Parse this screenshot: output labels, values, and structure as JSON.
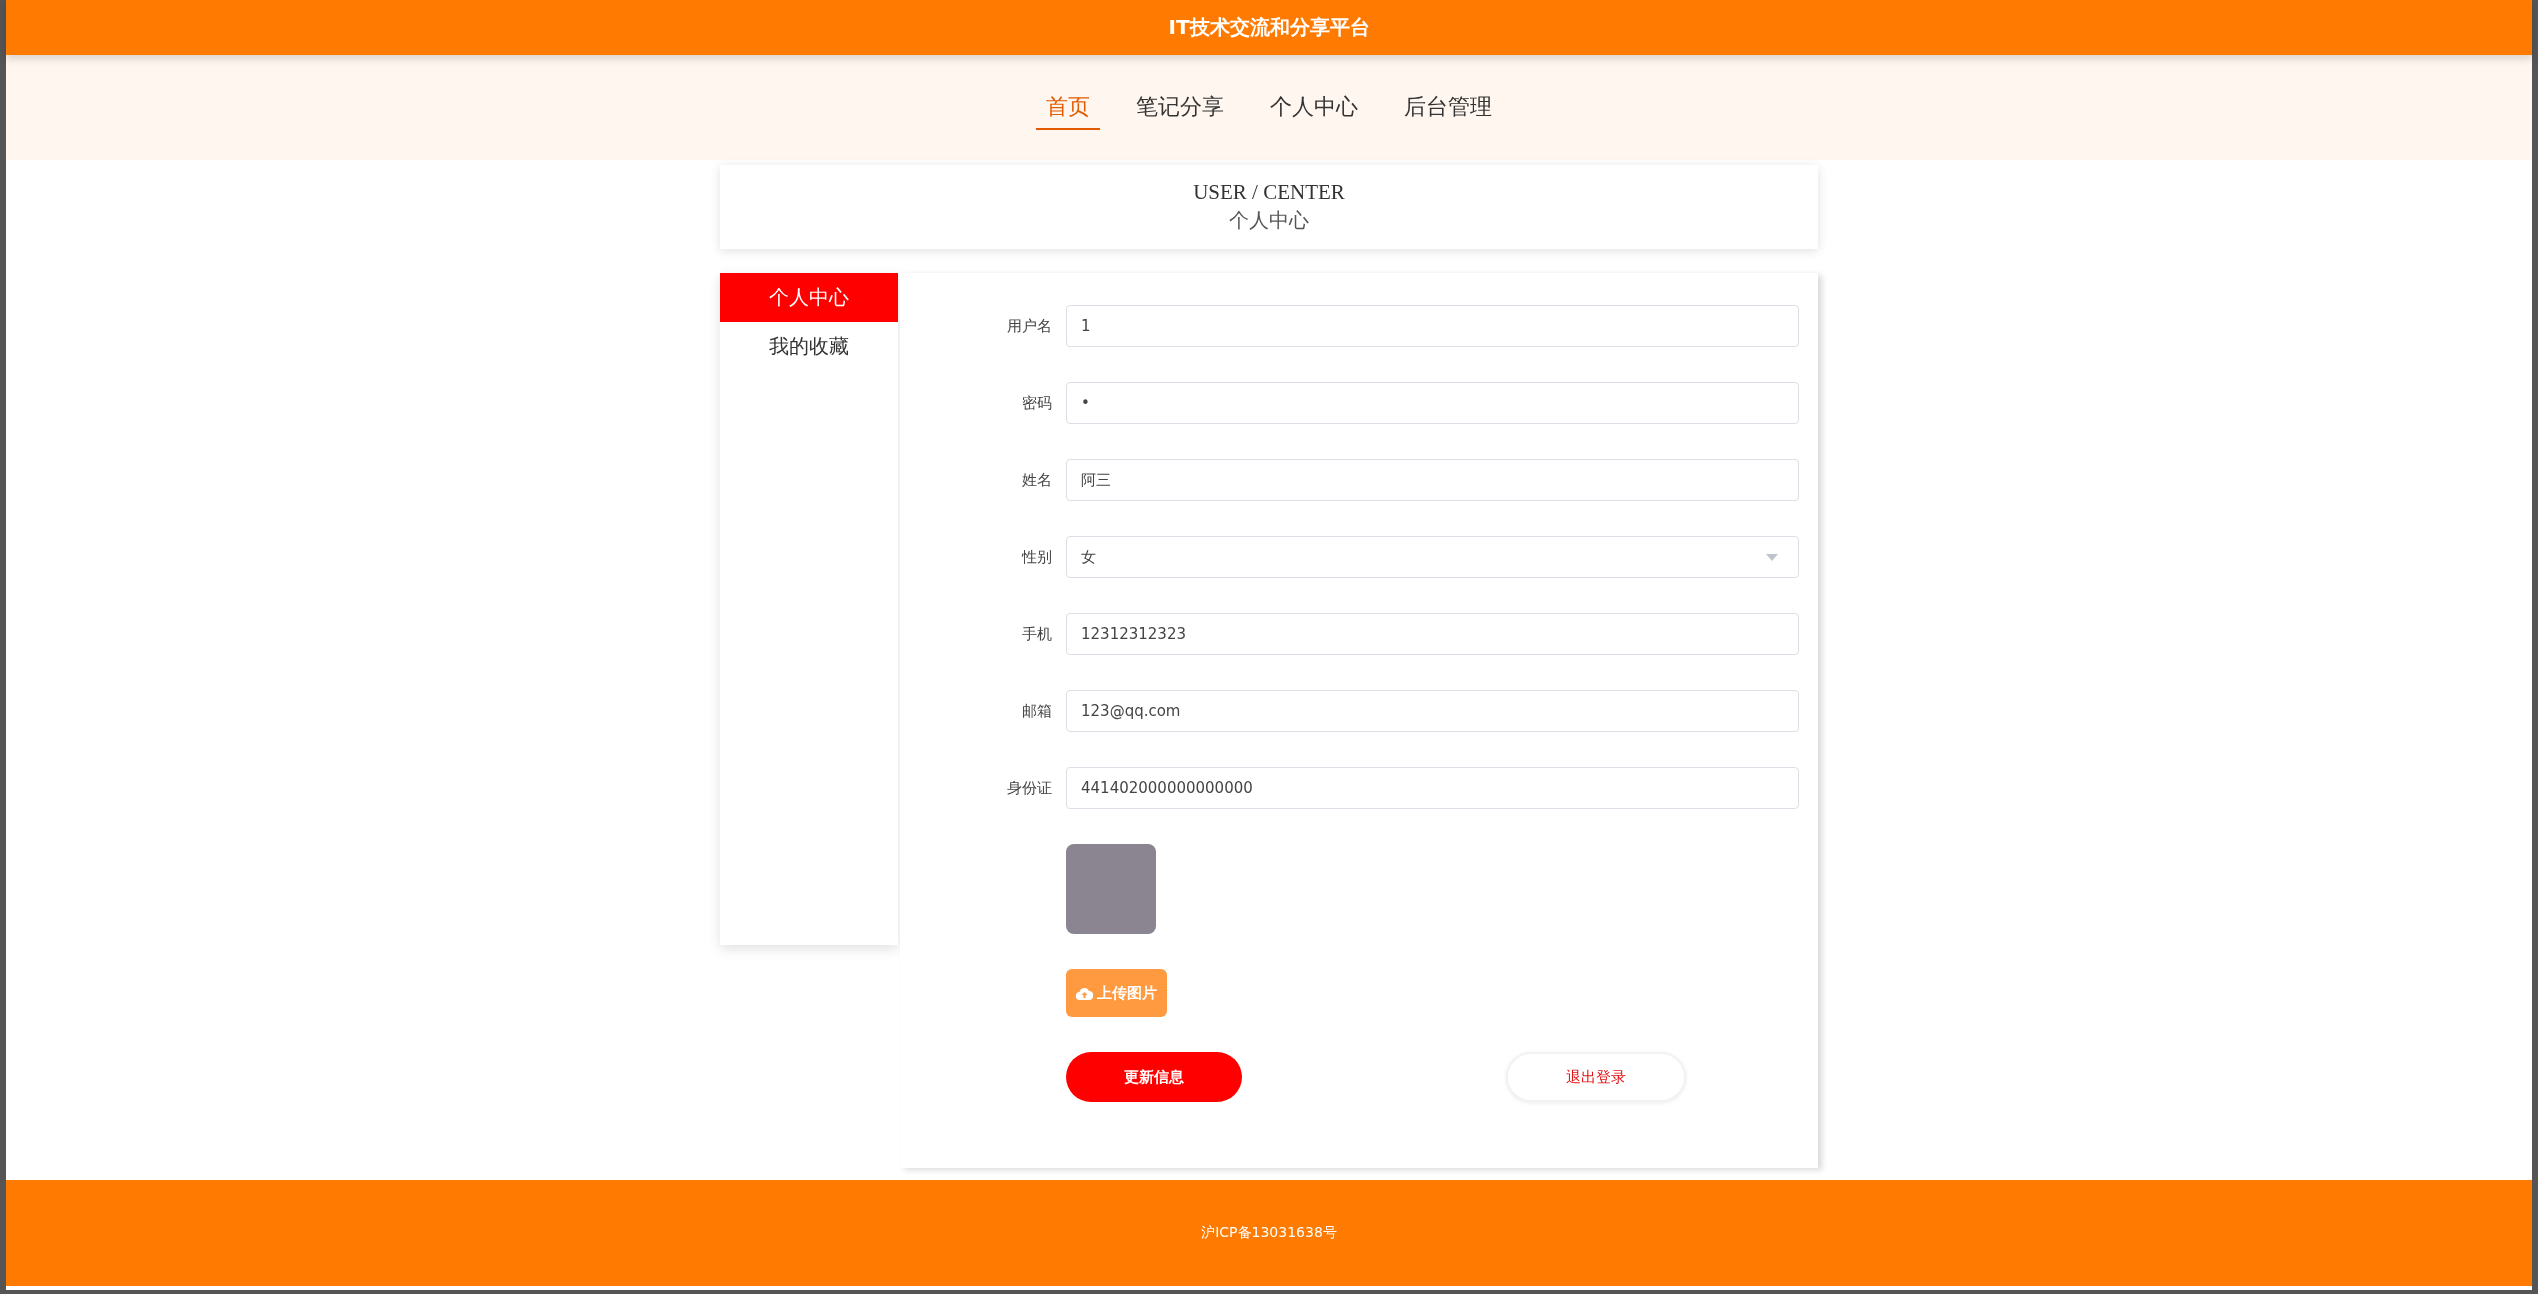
{
  "header": {
    "title": "IT技术交流和分享平台"
  },
  "nav": [
    {
      "label": "首页",
      "selected": true
    },
    {
      "label": "笔记分享",
      "selected": false
    },
    {
      "label": "个人中心",
      "selected": false
    },
    {
      "label": "后台管理",
      "selected": false
    }
  ],
  "page_title": {
    "english": "USER / CENTER",
    "chinese": "个人中心"
  },
  "sidebar": {
    "items": [
      {
        "label": "个人中心",
        "selected": true
      },
      {
        "label": "我的收藏",
        "selected": false
      }
    ]
  },
  "form": {
    "fields": [
      {
        "label": "用户名",
        "kind": "text",
        "value": "1"
      },
      {
        "label": "密码",
        "kind": "password",
        "value": "•"
      },
      {
        "label": "姓名",
        "kind": "text",
        "value": "阿三"
      },
      {
        "label": "性别",
        "kind": "select",
        "value": "女"
      },
      {
        "label": "手机",
        "kind": "text",
        "value": "12312312323"
      },
      {
        "label": "邮箱",
        "kind": "text",
        "value": "123@qq.com"
      },
      {
        "label": "身份证",
        "kind": "text",
        "value": "441402000000000000"
      }
    ],
    "upload_button": "上传图片",
    "buttons": [
      {
        "label": "更新信息",
        "kind": "primary"
      },
      {
        "label": "退出登录",
        "kind": "secondary"
      }
    ]
  },
  "footer": {
    "text": "沪ICP备13031638号"
  }
}
